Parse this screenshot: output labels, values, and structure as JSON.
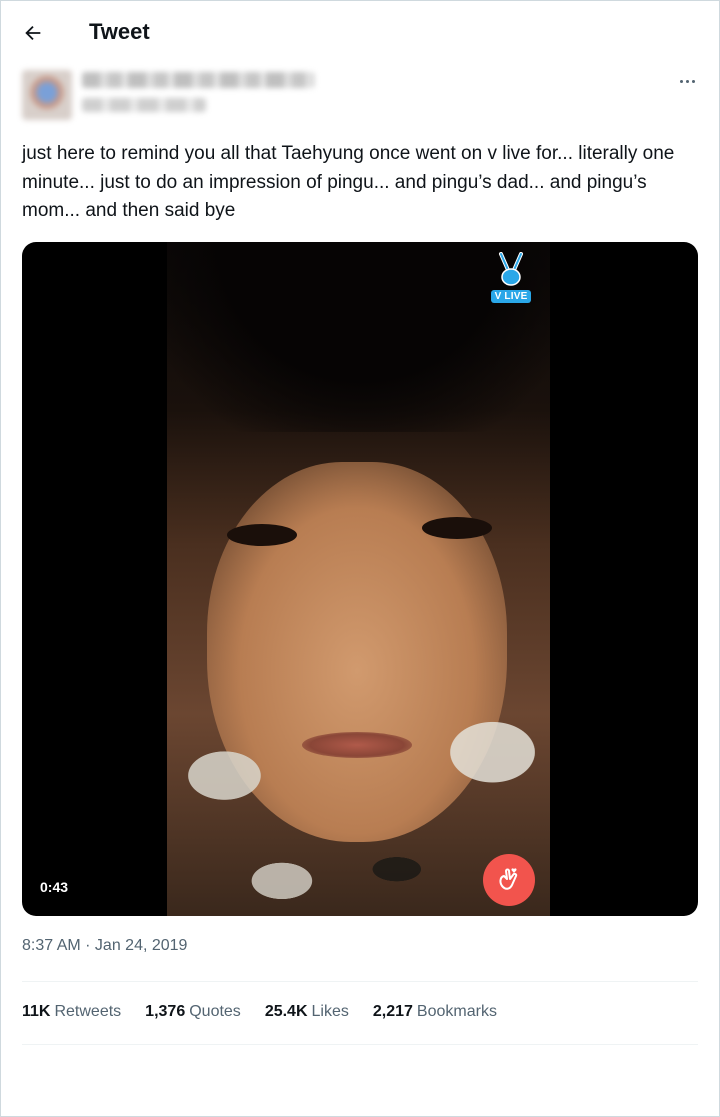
{
  "header": {
    "title": "Tweet",
    "back_icon": "arrow-left-icon"
  },
  "author": {
    "more_icon": "more-horizontal-icon"
  },
  "tweet": {
    "text": "just here to remind you all that Taehyung once went on v live for... literally one minute... just to do an impression of pingu... and pingu’s dad... and pingu’s mom... and then said bye",
    "media": {
      "overlay_logo_text": "V LIVE",
      "duration": "0:43",
      "reaction_icon": "finger-heart-icon",
      "reaction_color": "#f2544d"
    },
    "timestamp": "8:37 AM · Jan 24, 2019"
  },
  "stats": [
    {
      "count": "11K",
      "label": "Retweets"
    },
    {
      "count": "1,376",
      "label": "Quotes"
    },
    {
      "count": "25.4K",
      "label": "Likes"
    },
    {
      "count": "2,217",
      "label": "Bookmarks"
    }
  ],
  "colors": {
    "text_primary": "#0f1419",
    "text_secondary": "#536471",
    "border": "#cfd9de",
    "vlive_blue": "#2aa7e8"
  }
}
